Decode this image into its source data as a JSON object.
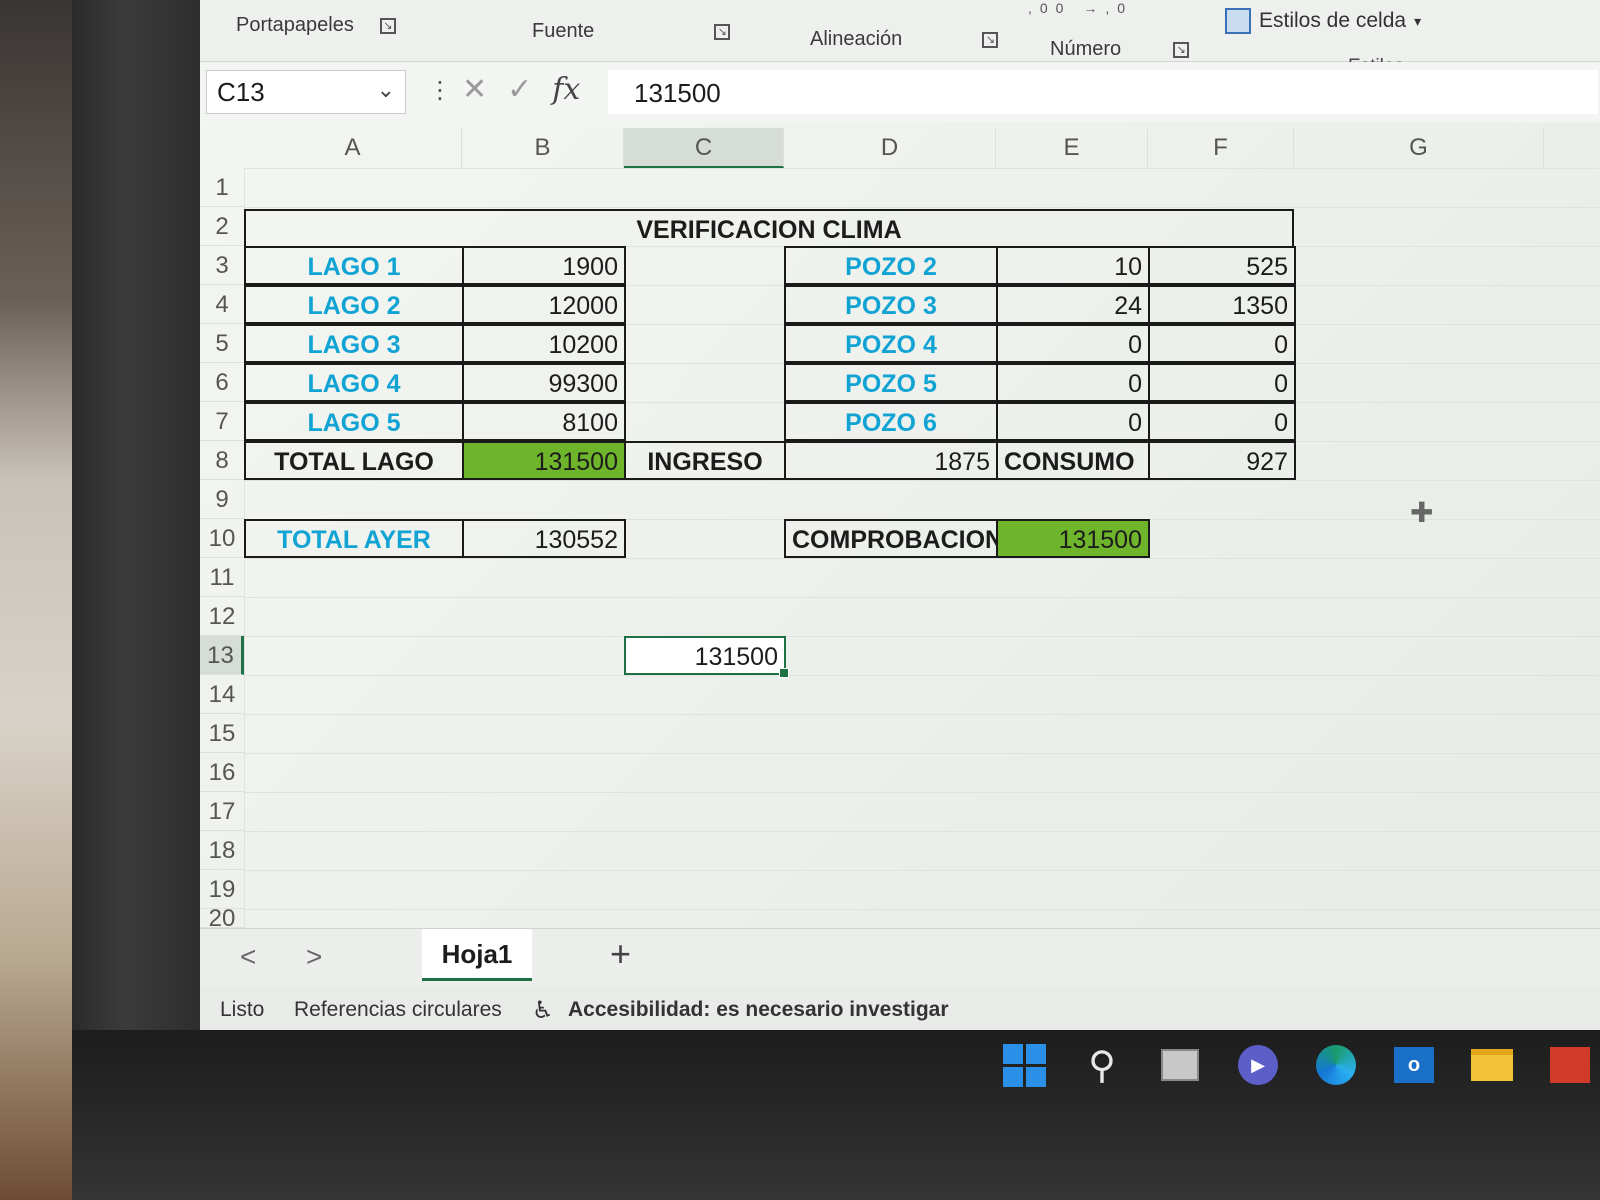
{
  "ribbon": {
    "groups": [
      "Portapapeles",
      "Fuente",
      "Alineación",
      "Número"
    ],
    "styles_button": "Estilos de celda",
    "styles_group": "Estilos",
    "number_icons": ",00 →,0"
  },
  "formula_bar": {
    "name_box": "C13",
    "fx": "fx",
    "value": "131500"
  },
  "columns": [
    "A",
    "B",
    "C",
    "D",
    "E",
    "F",
    "G"
  ],
  "rows": [
    "1",
    "2",
    "3",
    "4",
    "5",
    "6",
    "7",
    "8",
    "9",
    "10",
    "11",
    "12",
    "13",
    "14",
    "15",
    "16",
    "17",
    "18",
    "19",
    "20"
  ],
  "sheet": {
    "title": "VERIFICACION CLIMA",
    "lagos": [
      {
        "name": "LAGO 1",
        "value": "1900"
      },
      {
        "name": "LAGO 2",
        "value": "12000"
      },
      {
        "name": "LAGO 3",
        "value": "10200"
      },
      {
        "name": "LAGO 4",
        "value": "99300"
      },
      {
        "name": "LAGO 5",
        "value": "8100"
      }
    ],
    "total_lago_label": "TOTAL LAGO",
    "total_lago_value": "131500",
    "ingreso_label": "INGRESO",
    "pozos": [
      {
        "name": "POZO 2",
        "e": "10",
        "f": "525"
      },
      {
        "name": "POZO 3",
        "e": "24",
        "f": "1350"
      },
      {
        "name": "POZO 4",
        "e": "0",
        "f": "0"
      },
      {
        "name": "POZO 5",
        "e": "0",
        "f": "0"
      },
      {
        "name": "POZO 6",
        "e": "0",
        "f": "0"
      }
    ],
    "ingreso_value": "1875",
    "consumo_label": "CONSUMO",
    "consumo_value": "927",
    "total_ayer_label": "TOTAL AYER",
    "total_ayer_value": "130552",
    "comprobacion_label": "COMPROBACION",
    "comprobacion_value": "131500",
    "c13_value": "131500"
  },
  "tabs": {
    "sheet_name": "Hoja1",
    "add": "+",
    "prev": "<",
    "next": ">"
  },
  "status": {
    "ready": "Listo",
    "circular": "Referencias circulares",
    "accessibility": "Accesibilidad: es necesario investigar"
  },
  "colors": {
    "accent_green": "#6fb52c",
    "label_blue": "#11a3d4",
    "excel_green": "#1e7145"
  }
}
